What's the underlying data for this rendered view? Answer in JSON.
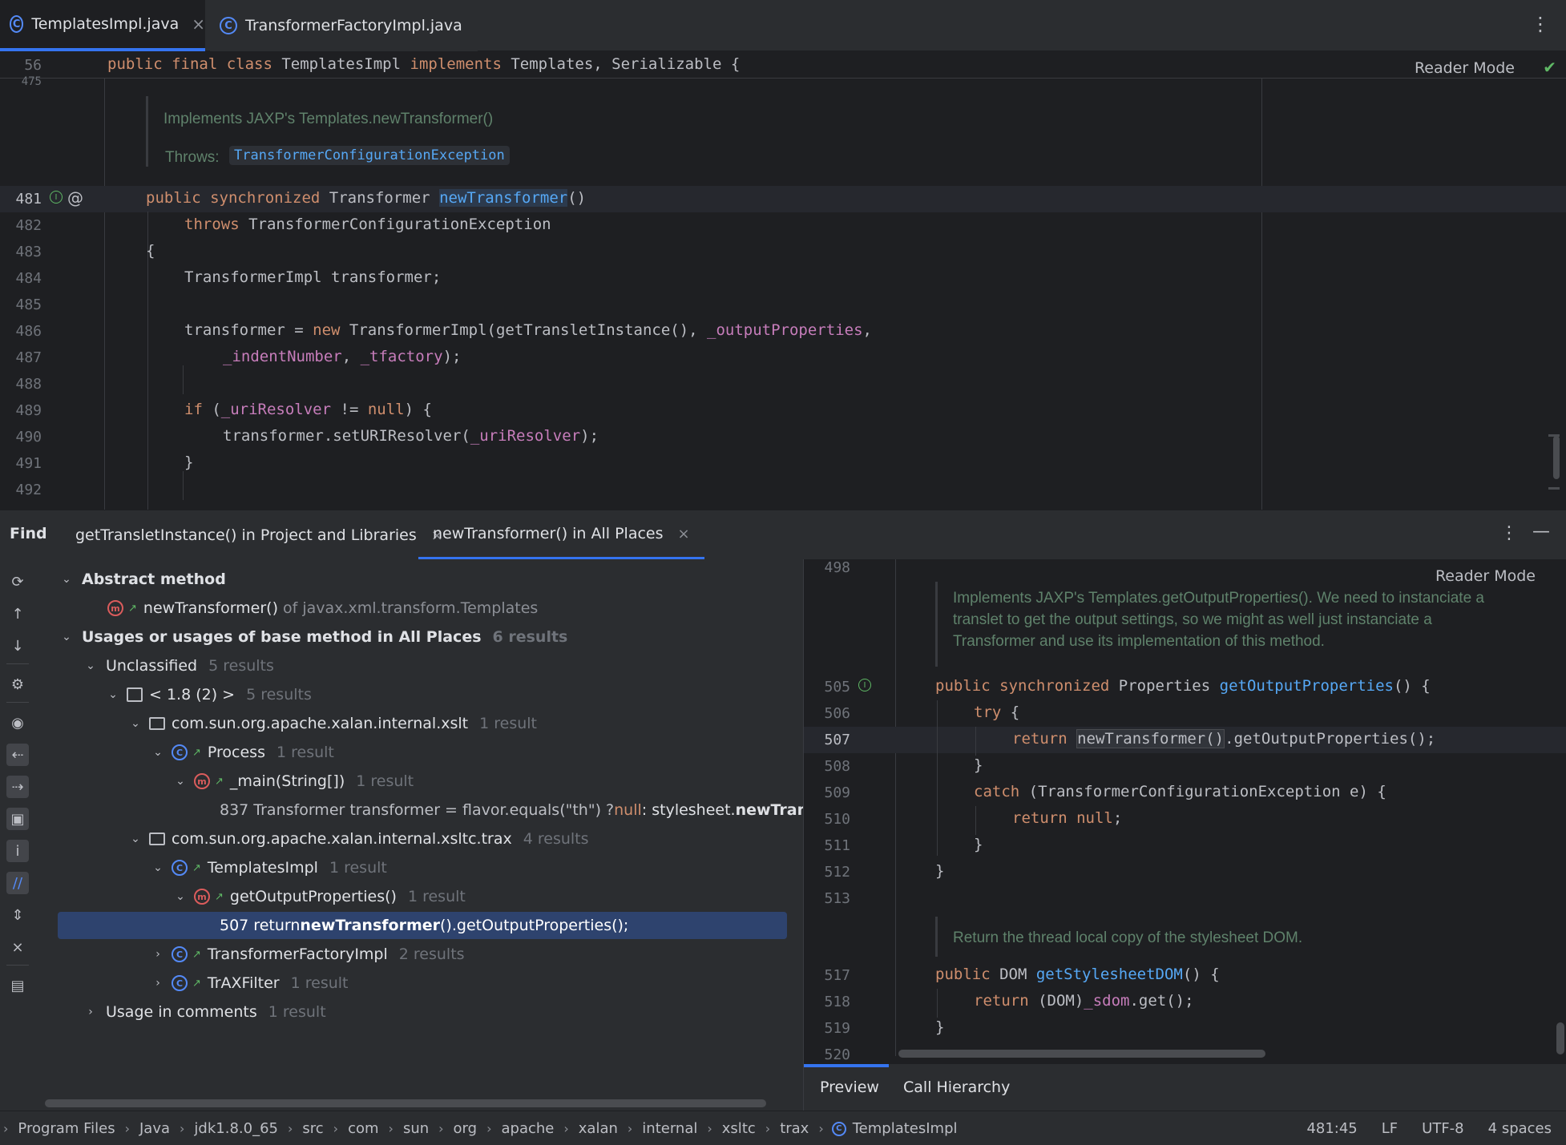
{
  "tabs": [
    {
      "label": "TemplatesImpl.java",
      "active": true
    },
    {
      "label": "TransformerFactoryImpl.java",
      "active": false
    }
  ],
  "editor": {
    "reader_mode": "Reader Mode",
    "sticky": {
      "line": "56",
      "code_kw1": "public final class",
      "code_name": " TemplatesImpl ",
      "code_kw2": "implements",
      "code_rest": " Templates, Serializable {"
    },
    "partial_line": "475",
    "doc_summary": "Implements JAXP's Templates.newTransformer()",
    "doc_throws_label": "Throws:",
    "doc_throws_value": "TransformerConfigurationException",
    "lines": [
      {
        "n": "481"
      },
      {
        "n": "482"
      },
      {
        "n": "483"
      },
      {
        "n": "484"
      },
      {
        "n": "485"
      },
      {
        "n": "486"
      },
      {
        "n": "487"
      },
      {
        "n": "488"
      },
      {
        "n": "489"
      },
      {
        "n": "490"
      },
      {
        "n": "491"
      },
      {
        "n": "492"
      }
    ],
    "code": {
      "l481_kw": "public synchronized",
      "l481_type": " Transformer ",
      "l481_fn": "newTransformer",
      "l481_end": "()",
      "l482_kw": "throws",
      "l482_rest": " TransformerConfigurationException",
      "l483": "{",
      "l484": "TransformerImpl transformer;",
      "l486_a": "transformer = ",
      "l486_kw": "new",
      "l486_b": " TransformerImpl(getTransletInstance(), ",
      "l486_f": "_outputProperties",
      "l486_c": ",",
      "l487_f1": "_indentNumber",
      "l487_a": ", ",
      "l487_f2": "_tfactory",
      "l487_b": ");",
      "l489_kw": "if",
      "l489_a": " (",
      "l489_f": "_uriResolver",
      "l489_b": " != ",
      "l489_kw2": "null",
      "l489_c": ") {",
      "l490_a": "transformer.setURIResolver(",
      "l490_f": "_uriResolver",
      "l490_b": ");",
      "l491": "}"
    }
  },
  "find": {
    "title": "Find",
    "tabs": [
      {
        "label": "getTransletInstance() in Project and Libraries"
      },
      {
        "label": "newTransformer() in All Places"
      }
    ],
    "tree": {
      "abstract_method": "Abstract method",
      "abstract_item": "newTransformer()",
      "abstract_item_of": "of javax.xml.transform.Templates",
      "usages": "Usages or usages of base method in All Places",
      "usages_count": "6 results",
      "unclassified": "Unclassified",
      "unclassified_count": "5 results",
      "jdk": "< 1.8 (2) >",
      "jdk_count": "5 results",
      "pkg1": "com.sun.org.apache.xalan.internal.xslt",
      "pkg1_count": "1 result",
      "process": "Process",
      "process_count": "1 result",
      "main": "_main(String[])",
      "main_count": "1 result",
      "line837_a": "837 Transformer transformer = flavor.equals(\"th\") ? ",
      "line837_null": "null",
      "line837_b": " : stylesheet.",
      "line837_bold": "newTransformer",
      "pkg2": "com.sun.org.apache.xalan.internal.xsltc.trax",
      "pkg2_count": "4 results",
      "templatesimpl": "TemplatesImpl",
      "templatesimpl_count": "1 result",
      "getoutput": "getOutputProperties()",
      "getoutput_count": "1 result",
      "line507_a": "507 return ",
      "line507_bold": "newTransformer",
      "line507_b": "().getOutputProperties();",
      "tfi": "TransformerFactoryImpl",
      "tfi_count": "2 results",
      "traxfilter": "TrAXFilter",
      "traxfilter_count": "1 result",
      "comments": "Usage in comments",
      "comments_count": "1 result"
    }
  },
  "preview": {
    "reader_mode": "Reader Mode",
    "line498": "498",
    "doc1": "Implements JAXP's Templates.getOutputProperties(). We need to instanciate a",
    "doc2": "translet to get the output settings, so we might as well just instanciate a",
    "doc3": "Transformer and use its implementation of this method.",
    "l505": "505",
    "l506": "506",
    "l507": "507",
    "l508": "508",
    "l509": "509",
    "l510": "510",
    "l511": "511",
    "l512": "512",
    "l513": "513",
    "l517": "517",
    "l518": "518",
    "l519": "519",
    "l520": "520",
    "c505_kw": "public synchronized",
    "c505_type": " Properties ",
    "c505_fn": "getOutputProperties",
    "c505_end": "() {",
    "c506_kw": "try",
    "c506_end": " {",
    "c507_kw": "return",
    "c507_sp": " ",
    "c507_hl": "newTransformer()",
    "c507_end": ".getOutputProperties();",
    "c508": "}",
    "c509_kw": "catch",
    "c509_end": " (TransformerConfigurationException e) {",
    "c510_kw": "return",
    "c510_null": " null",
    "c510_end": ";",
    "c511": "}",
    "c512": "}",
    "doc4": "Return the thread local copy of the stylesheet DOM.",
    "c517_kw": "public",
    "c517_type": " DOM ",
    "c517_fn": "getStylesheetDOM",
    "c517_end": "() {",
    "c518_kw": "return",
    "c518_a": " (DOM)",
    "c518_f": "_sdom",
    "c518_b": ".get();",
    "c519": "}",
    "tabs": [
      {
        "label": "Preview"
      },
      {
        "label": "Call Hierarchy"
      }
    ]
  },
  "status": {
    "crumbs": [
      "Program Files",
      "Java",
      "jdk1.8.0_65",
      "src",
      "com",
      "sun",
      "org",
      "apache",
      "xalan",
      "internal",
      "xsltc",
      "trax",
      "TemplatesImpl"
    ],
    "position": "481:45",
    "line_sep": "LF",
    "encoding": "UTF-8",
    "indent": "4 spaces"
  },
  "colors": {
    "accent": "#3574f0",
    "keyword": "#cf8e6d",
    "field": "#c77dbb",
    "function": "#56a8f5",
    "doc": "#5f826b",
    "selection": "#2e436e"
  }
}
